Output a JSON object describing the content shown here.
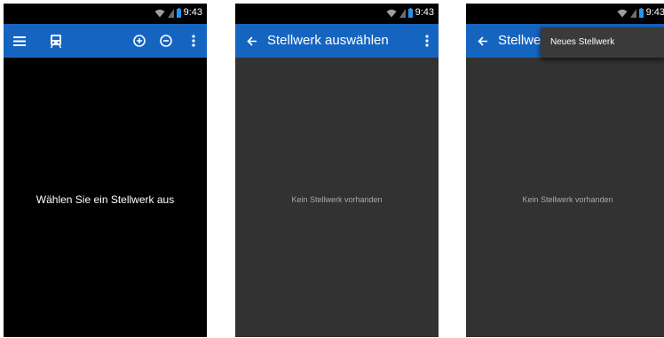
{
  "status_bar": {
    "time": "9:43"
  },
  "screen1": {
    "center_text": "Wählen Sie ein Stellwerk aus",
    "icons": [
      "menu-icon",
      "train-icon",
      "add-circle-icon",
      "remove-circle-icon",
      "overflow-menu-icon"
    ]
  },
  "screen2": {
    "title": "Stellwerk auswählen",
    "empty_text": "Kein Stellwerk vorhanden",
    "icons": [
      "back-arrow-icon",
      "overflow-menu-icon"
    ]
  },
  "screen3": {
    "title": "Stellwerk auswählen",
    "empty_text": "Kein Stellwerk vorhanden",
    "popup_items": [
      "Neues Stellwerk"
    ]
  },
  "colors": {
    "app_bar": "#1565c0",
    "status_bar": "#000000",
    "content_dark": "#323232",
    "popup": "#3a3a3a"
  }
}
